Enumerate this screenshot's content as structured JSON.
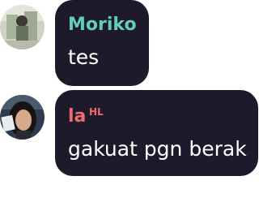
{
  "messages": [
    {
      "author": "Moriko",
      "author_color": "#5fd0b3",
      "text": "tes",
      "avatar": "moriko-avatar"
    },
    {
      "author": "la",
      "author_color": "#f06b6b",
      "badge": "HL",
      "text": "gakuat pgn berak",
      "avatar": "la-avatar"
    }
  ],
  "colors": {
    "bubble_bg": "#1f1a2b",
    "text": "#ffffff"
  }
}
